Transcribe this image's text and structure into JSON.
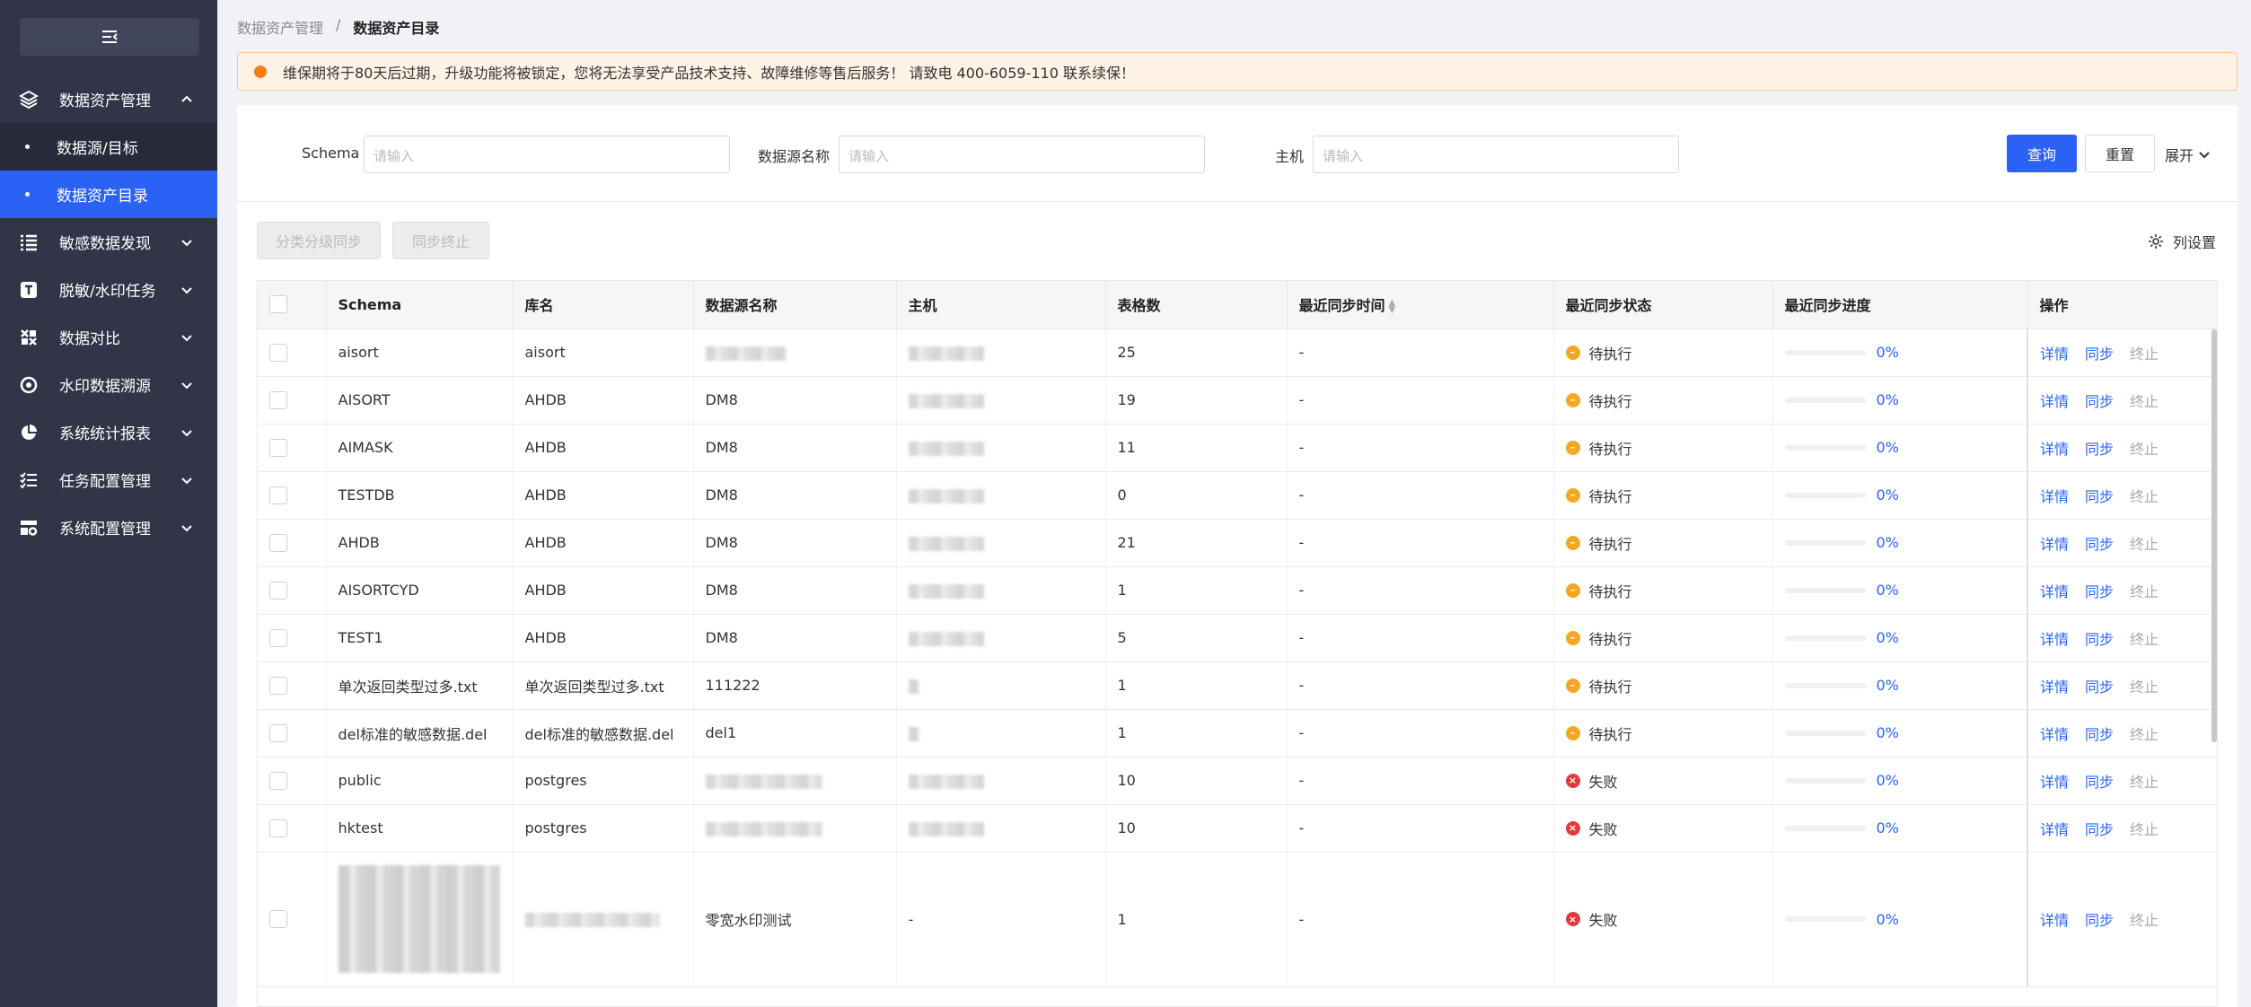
{
  "sidebar": {
    "items": [
      {
        "label": "数据资产管理",
        "icon": "layers-icon",
        "expanded": true
      },
      {
        "label": "数据源/目标",
        "sub": true
      },
      {
        "label": "数据资产目录",
        "sub": true,
        "active": true
      },
      {
        "label": "敏感数据发现",
        "icon": "list-icon"
      },
      {
        "label": "脱敏/水印任务",
        "icon": "text-icon"
      },
      {
        "label": "数据对比",
        "icon": "compare-icon"
      },
      {
        "label": "水印数据溯源",
        "icon": "target-icon"
      },
      {
        "label": "系统统计报表",
        "icon": "pie-icon"
      },
      {
        "label": "任务配置管理",
        "icon": "tasklist-icon"
      },
      {
        "label": "系统配置管理",
        "icon": "settings-icon"
      }
    ]
  },
  "breadcrumb": {
    "parent": "数据资产管理",
    "sep": "/",
    "current": "数据资产目录"
  },
  "notice": {
    "text": "维保期将于80天后过期，升级功能将被锁定，您将无法享受产品技术支持、故障维修等售后服务！ 请致电 400-6059-110 联系续保！",
    "color": "#fa7d14"
  },
  "filter": {
    "schema_label": "Schema",
    "schema_placeholder": "请输入",
    "ds_label": "数据源名称",
    "ds_placeholder": "请输入",
    "host_label": "主机",
    "host_placeholder": "请输入",
    "query": "查询",
    "reset": "重置",
    "expand": "展开"
  },
  "toolbar": {
    "sync_btn": "分类分级同步",
    "stop_btn": "同步终止",
    "col_settings": "列设置"
  },
  "table": {
    "headers": [
      "Schema",
      "库名",
      "数据源名称",
      "主机",
      "表格数",
      "最近同步时间",
      "最近同步状态",
      "最近同步进度",
      "操作"
    ],
    "ops": {
      "detail": "详情",
      "sync": "同步",
      "stop": "终止"
    },
    "rows": [
      {
        "schema": "aisort",
        "db": "aisort",
        "ds": "",
        "host": "",
        "count": "25",
        "time": "-",
        "status": "待执行",
        "progress": "0%"
      },
      {
        "schema": "AISORT",
        "db": "AHDB",
        "ds": "DM8",
        "host": "",
        "count": "19",
        "time": "-",
        "status": "待执行",
        "progress": "0%"
      },
      {
        "schema": "AIMASK",
        "db": "AHDB",
        "ds": "DM8",
        "host": "",
        "count": "11",
        "time": "-",
        "status": "待执行",
        "progress": "0%"
      },
      {
        "schema": "TESTDB",
        "db": "AHDB",
        "ds": "DM8",
        "host": "",
        "count": "0",
        "time": "-",
        "status": "待执行",
        "progress": "0%"
      },
      {
        "schema": "AHDB",
        "db": "AHDB",
        "ds": "DM8",
        "host": "",
        "count": "21",
        "time": "-",
        "status": "待执行",
        "progress": "0%"
      },
      {
        "schema": "AISORTCYD",
        "db": "AHDB",
        "ds": "DM8",
        "host": "",
        "count": "1",
        "time": "-",
        "status": "待执行",
        "progress": "0%"
      },
      {
        "schema": "TEST1",
        "db": "AHDB",
        "ds": "DM8",
        "host": "",
        "count": "5",
        "time": "-",
        "status": "待执行",
        "progress": "0%"
      },
      {
        "schema": "单次返回类型过多.txt",
        "db": "单次返回类型过多.txt",
        "ds": "111222",
        "host": "",
        "count": "1",
        "time": "-",
        "status": "待执行",
        "progress": "0%"
      },
      {
        "schema": "del标准的敏感数据.del",
        "db": "del标准的敏感数据.del",
        "ds": "del1",
        "host": "",
        "count": "1",
        "time": "-",
        "status": "待执行",
        "progress": "0%"
      },
      {
        "schema": "public",
        "db": "postgres",
        "ds": "",
        "host": "",
        "count": "10",
        "time": "-",
        "status": "失败",
        "progress": "0%"
      },
      {
        "schema": "hktest",
        "db": "postgres",
        "ds": "",
        "host": "",
        "count": "10",
        "time": "-",
        "status": "失败",
        "progress": "0%"
      },
      {
        "schema": "",
        "db": "",
        "ds": "零宽水印测试",
        "host": "-",
        "count": "1",
        "time": "-",
        "status": "失败",
        "progress": "0%"
      }
    ]
  },
  "colors": {
    "primary": "#2b62f6",
    "sidebar": "#323548",
    "pending": "#f5a623",
    "fail": "#e4393c"
  }
}
